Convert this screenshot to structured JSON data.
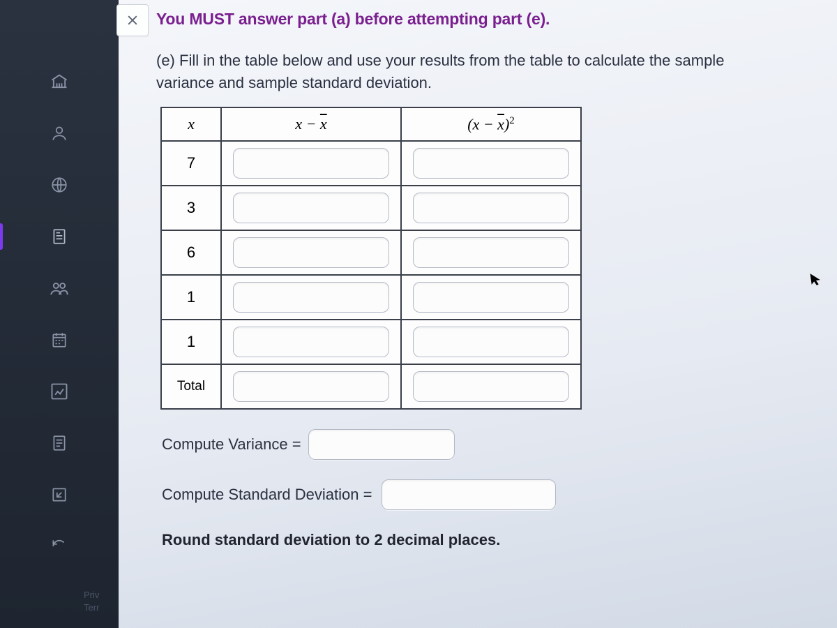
{
  "sidebar": {
    "icons": [
      {
        "name": "institution-icon"
      },
      {
        "name": "person-icon"
      },
      {
        "name": "globe-icon"
      },
      {
        "name": "document-icon"
      },
      {
        "name": "people-icon"
      },
      {
        "name": "calendar-icon"
      },
      {
        "name": "chart-icon"
      },
      {
        "name": "note-icon"
      },
      {
        "name": "edit-icon"
      },
      {
        "name": "refresh-icon"
      }
    ],
    "bottom_links": {
      "privacy": "Priv",
      "terms": "Terr"
    }
  },
  "close_button": {
    "label": "✕"
  },
  "warning_text": "You MUST answer part (a) before attempting part (e).",
  "part_label": "(e)",
  "instructions_text": "Fill in the table below and use your results from the table to calculate the sample variance and sample standard deviation.",
  "table": {
    "headers": {
      "x": "x",
      "diff": "x − x̄",
      "diff_sq": "(x − x̄)²"
    },
    "rows": [
      {
        "x": "7",
        "diff": "",
        "diff_sq": ""
      },
      {
        "x": "3",
        "diff": "",
        "diff_sq": ""
      },
      {
        "x": "6",
        "diff": "",
        "diff_sq": ""
      },
      {
        "x": "1",
        "diff": "",
        "diff_sq": ""
      },
      {
        "x": "1",
        "diff": "",
        "diff_sq": ""
      }
    ],
    "total_label": "Total",
    "total": {
      "diff": "",
      "diff_sq": ""
    }
  },
  "compute": {
    "variance_label": "Compute Variance =",
    "variance_value": "",
    "stddev_label": "Compute Standard Deviation =",
    "stddev_value": ""
  },
  "round_note": "Round standard deviation to 2 decimal places."
}
